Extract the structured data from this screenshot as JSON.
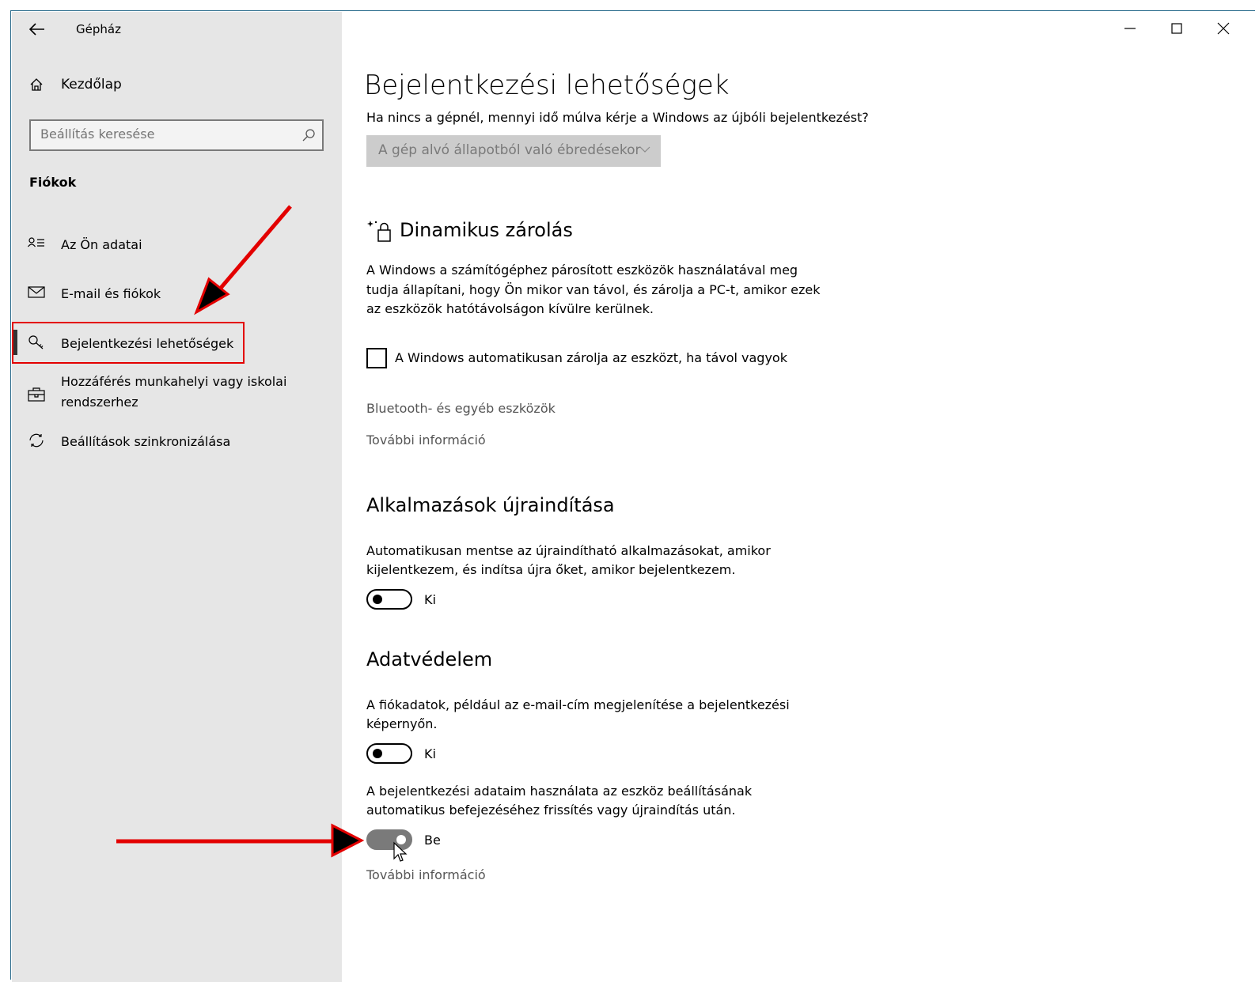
{
  "window": {
    "app_title": "Gépház",
    "minimize_icon": "minimize-icon",
    "maximize_icon": "maximize-icon",
    "close_icon": "close-icon"
  },
  "sidebar": {
    "home_label": "Kezdőlap",
    "search_placeholder": "Beállítás keresése",
    "section_label": "Fiókok",
    "items": [
      {
        "label": "Az Ön adatai",
        "icon": "person-list-icon"
      },
      {
        "label": "E-mail és fiókok",
        "icon": "mail-icon"
      },
      {
        "label": "Bejelentkezési lehetőségek",
        "icon": "key-icon",
        "active": true
      },
      {
        "label_line1": "Hozzáférés munkahelyi vagy iskolai",
        "label_line2": "rendszerhez",
        "icon": "briefcase-icon"
      },
      {
        "label": "Beállítások szinkronizálása",
        "icon": "sync-icon"
      }
    ]
  },
  "main": {
    "page_title": "Bejelentkezési lehetőségek",
    "require_signin_question": "Ha nincs a gépnél, mennyi idő múlva kérje a Windows az újbóli bejelentkezést?",
    "require_signin_value": "A gép alvó állapotból való ébredésekor",
    "dynamic_lock": {
      "title": "Dinamikus zárolás",
      "desc_line1": "A Windows a számítógéphez párosított eszközök használatával meg",
      "desc_line2": "tudja állapítani, hogy Ön mikor van távol, és zárolja a PC-t, amikor ezek",
      "desc_line3": "az eszközök hatótávolságon kívülre kerülnek.",
      "checkbox_label": "A Windows automatikusan zárolja az eszközt, ha távol vagyok",
      "checkbox_checked": false,
      "link_bluetooth": "Bluetooth- és egyéb eszközök",
      "link_more_info": "További információ"
    },
    "restart_apps": {
      "title": "Alkalmazások újraindítása",
      "desc_line1": "Automatikusan mentse az újraindítható alkalmazásokat, amikor",
      "desc_line2": "kijelentkezem, és indítsa újra őket, amikor bejelentkezem.",
      "toggle_state": "Ki",
      "toggle_on": false
    },
    "privacy": {
      "title": "Adatvédelem",
      "desc1_line1": "A fiókadatok, például az e-mail-cím megjelenítése a bejelentkezési",
      "desc1_line2": "képernyőn.",
      "toggle1_state": "Ki",
      "toggle1_on": false,
      "desc2_line1": "A bejelentkezési adataim használata az eszköz beállításának",
      "desc2_line2": "automatikus befejezéséhez frissítés vagy újraindítás után.",
      "toggle2_state": "Be",
      "toggle2_on": true,
      "link_more_info": "További információ"
    }
  },
  "annotations": {
    "arrow_color": "#e30000",
    "highlight_color": "#e30000"
  }
}
